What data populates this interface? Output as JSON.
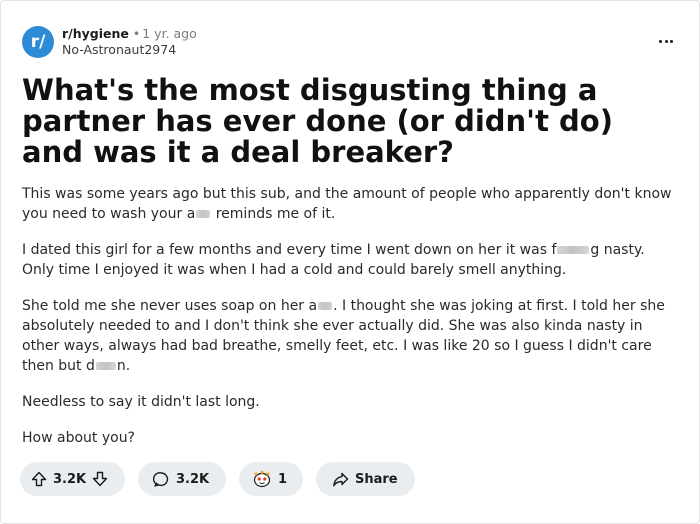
{
  "post": {
    "subreddit_avatar": "r/",
    "subreddit": "r/hygiene",
    "separator": "•",
    "age": "1 yr. ago",
    "author": "No-Astronaut2974",
    "title_lines": [
      "What's the most disgusting thing a",
      "partner has ever done (or didn't do)",
      "and was it a deal breaker?"
    ],
    "paragraphs": {
      "p1": {
        "l1": "This was some years ago but this sub, and the amount of people who apparently don't know",
        "l2a": "you need to wash your a",
        "l2b": " reminds me of it."
      },
      "p2": {
        "l1a": "I dated this girl for a few months and every time I went down on her it was f",
        "l1b": "g nasty.",
        "l2": "Only time I enjoyed it was when I had a cold and could barely smell anything."
      },
      "p3": {
        "l1a": "She told me she never uses soap on her a",
        "l1b": ". I thought she was joking at first. I told her she",
        "l2": "absolutely needed to and I don't think she ever actually did. She was also kinda nasty in",
        "l3": "other ways, always had bad breathe, smelly feet, etc. I was like 20 so I guess I didn't care",
        "l4a": "then but d",
        "l4b": "n."
      },
      "p4": "Needless to say it didn't last long.",
      "p5": "How about you?"
    }
  },
  "actions": {
    "upvotes": "3.2K",
    "comments": "3.2K",
    "awards": "1",
    "share": "Share"
  },
  "icons": {
    "more": "more-options-icon",
    "upvote": "upvote-arrow-icon",
    "downvote": "downvote-arrow-icon",
    "comment": "comment-bubble-icon",
    "award": "award-icon",
    "share": "share-arrow-icon"
  },
  "colors": {
    "avatar_bg": "#2e8bd6",
    "pill_bg": "#e9edf0",
    "text": "#1c1c1c",
    "muted": "#7c7c7c"
  }
}
